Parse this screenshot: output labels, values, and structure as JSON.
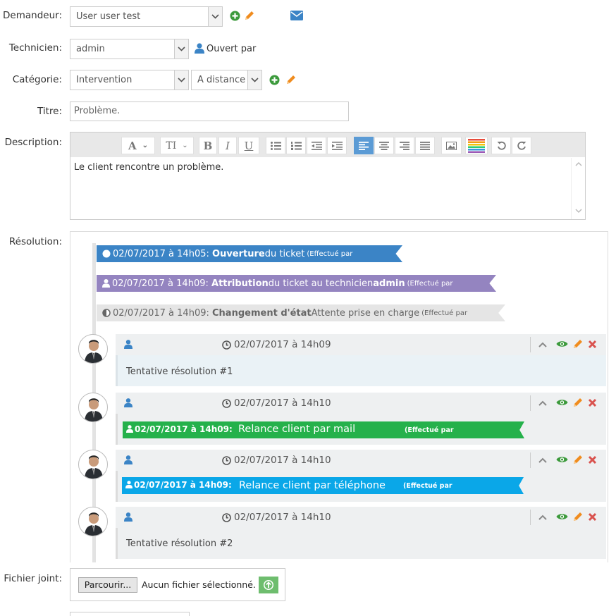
{
  "form": {
    "demandeur": {
      "label": "Demandeur:",
      "value": "User user test"
    },
    "technicien": {
      "label": "Technicien:",
      "value": "admin",
      "opened_by": "Ouvert par"
    },
    "categorie": {
      "label": "Catégorie:",
      "value": "Intervention",
      "mode": "A distance"
    },
    "titre": {
      "label": "Titre:",
      "value": "Problème."
    },
    "description": {
      "label": "Description:",
      "content": "Le client rencontre un problème."
    },
    "resolution": {
      "label": "Résolution:"
    },
    "fichier": {
      "label": "Fichier joint:",
      "button": "Parcourir...",
      "status": "Aucun fichier sélectionné."
    }
  },
  "timeline": {
    "events": [
      {
        "date": "02/07/2017 à 14h05:",
        "bold": "Ouverture",
        "text": " du ticket ",
        "small": "(Effectué par",
        "color": "#3b84c6"
      },
      {
        "date": "02/07/2017 à 14h09:",
        "bold": "Attribution",
        "text": " du ticket au technicien ",
        "bold2": "admin",
        "small": "(Effectué par",
        "color": "#9484c0"
      },
      {
        "date": "02/07/2017 à 14h09:",
        "bold": "Changement d'état",
        "text": " Attente prise en charge ",
        "small": "(Effectué par",
        "color": "#e5e5e5"
      }
    ],
    "entries": [
      {
        "date": "02/07/2017 à 14h09",
        "body": "Tentative résolution #1"
      },
      {
        "date": "02/07/2017 à 14h10",
        "banner_date": "02/07/2017 à 14h09:",
        "banner_text": "Relance client par mail",
        "banner_small": "(Effectué par",
        "banner_color": "#25b14b"
      },
      {
        "date": "02/07/2017 à 14h10",
        "banner_date": "02/07/2017 à 14h09:",
        "banner_text": "Relance client par téléphone",
        "banner_small": "(Effectué par",
        "banner_color": "#0aa7e8"
      },
      {
        "date": "02/07/2017 à 14h10",
        "body": "Tentative résolution #2"
      }
    ]
  },
  "toolbar": {
    "font": "A",
    "size": "TI",
    "bold": "B",
    "italic": "I",
    "underline": "U"
  },
  "colors": {
    "accent": "#5b9bd5",
    "green": "#3c9a3c",
    "orange": "#f08c1e",
    "red": "#d9534f"
  }
}
